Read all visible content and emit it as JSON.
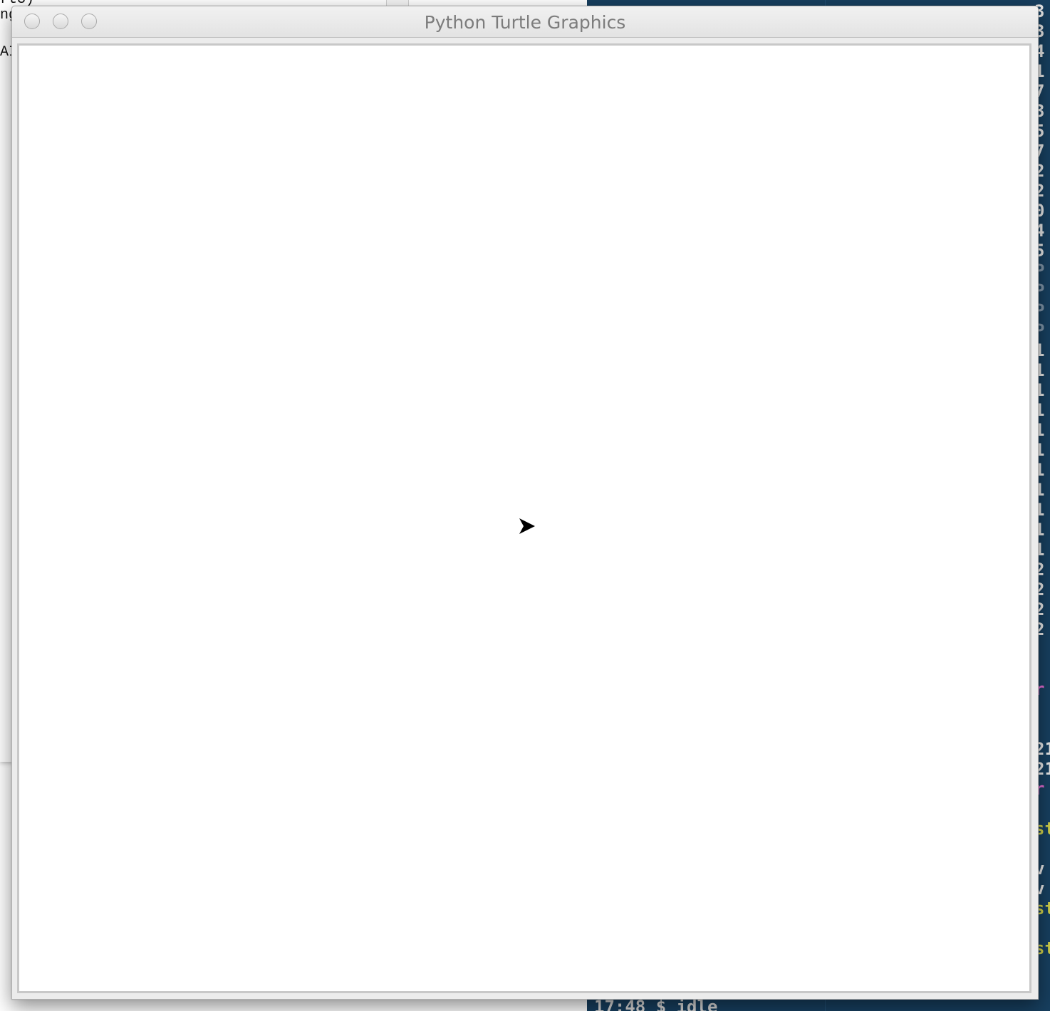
{
  "background_editor": {
    "visible_fragments": [
      "rt3)",
      "ng",
      "AI"
    ]
  },
  "terminal": {
    "right_edge_chars": [
      "3",
      "3",
      "4",
      "1",
      "7",
      "3",
      "5",
      "7",
      "2",
      "2",
      "0",
      "4",
      "5",
      "P",
      "P",
      "P",
      "P",
      "1",
      "1",
      "1",
      "1",
      "1",
      "1",
      "1",
      "1",
      "1",
      "1",
      "1",
      "2",
      "2",
      "2",
      "2",
      "r",
      "21",
      "21",
      "r",
      "st",
      "v",
      "v",
      "st",
      "st"
    ],
    "prompt_line": "17:48 $ idle"
  },
  "turtle_window": {
    "title": "Python Turtle Graphics",
    "controls": {
      "close": "close-button",
      "minimize": "minimize-button",
      "zoom": "zoom-button"
    },
    "canvas": {
      "background": "#ffffff",
      "turtle_shape": "classic-arrow",
      "turtle_heading": "east",
      "turtle_color": "#000000"
    }
  },
  "colors": {
    "terminal_bg": "#173f5f",
    "window_chrome": "#ececec",
    "title_text": "#7c7c7c"
  }
}
